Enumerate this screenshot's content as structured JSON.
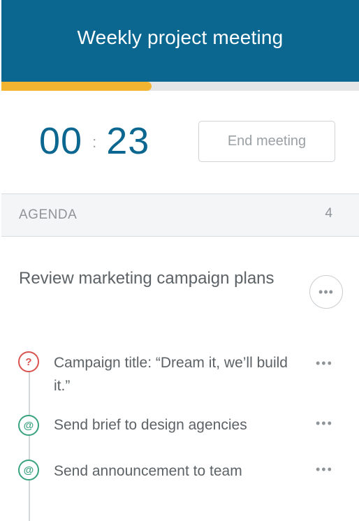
{
  "header": {
    "title": "Weekly project meeting"
  },
  "progress": {
    "fraction": 0.42,
    "color": "#f3b531"
  },
  "timer": {
    "minutes": "00",
    "separator": ":",
    "seconds": "23"
  },
  "end_button": {
    "label": "End meeting"
  },
  "agenda": {
    "label": "AGENDA",
    "count": "4"
  },
  "agenda_item": {
    "title": "Review marketing campaign plans",
    "more_label": "•••",
    "sub_items": [
      {
        "icon": "question-icon",
        "glyph": "?",
        "text": "Campaign title: “Dream it, we’ll build it.”",
        "more": "•••"
      },
      {
        "icon": "mention-icon",
        "glyph": "@",
        "text": "Send brief to design agencies",
        "more": "•••"
      },
      {
        "icon": "mention-icon",
        "glyph": "@",
        "text": "Send announcement to team",
        "more": "•••"
      }
    ]
  },
  "colors": {
    "header_bg": "#0b6790",
    "accent": "#0b6790",
    "question": "#d9534f",
    "mention": "#3aa37e"
  }
}
